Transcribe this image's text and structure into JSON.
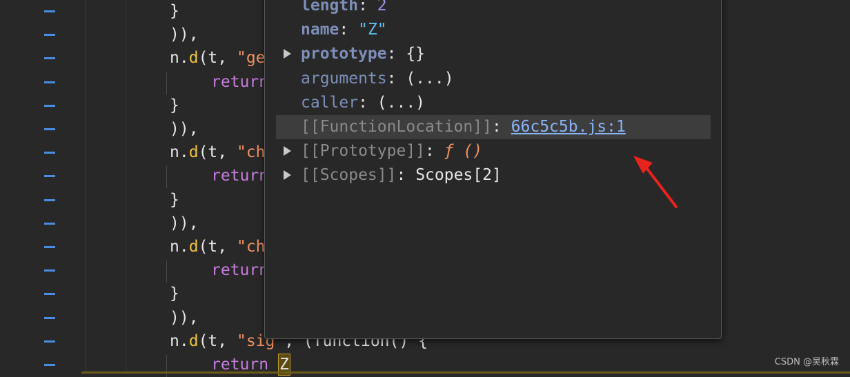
{
  "editor": {
    "lines": [
      {
        "kind": "brace",
        "text": "}"
      },
      {
        "kind": "close",
        "text": ")),"
      },
      {
        "kind": "call",
        "obj": "n",
        "dot": ".",
        "fn": "d",
        "open": "(t, ",
        "str": "\"ge"
      },
      {
        "kind": "return",
        "kw": "return"
      },
      {
        "kind": "brace",
        "text": "}"
      },
      {
        "kind": "close",
        "text": ")),"
      },
      {
        "kind": "call",
        "obj": "n",
        "dot": ".",
        "fn": "d",
        "open": "(t, ",
        "str": "\"ch"
      },
      {
        "kind": "return",
        "kw": "return"
      },
      {
        "kind": "brace",
        "text": "}"
      },
      {
        "kind": "close",
        "text": ")),"
      },
      {
        "kind": "call",
        "obj": "n",
        "dot": ".",
        "fn": "d",
        "open": "(t, ",
        "str": "\"ch"
      },
      {
        "kind": "return",
        "kw": "return"
      },
      {
        "kind": "brace",
        "text": "}"
      },
      {
        "kind": "close",
        "text": ")),"
      },
      {
        "kind": "call",
        "obj": "n",
        "dot": ".",
        "fn": "d",
        "open": "(t, ",
        "str": "\"sig",
        "tail": "\", (function() {"
      },
      {
        "kind": "return",
        "kw": "return",
        "hover": "Z"
      }
    ]
  },
  "popup": {
    "rows": [
      {
        "key": "length",
        "sep": ": ",
        "value": "2",
        "vtype": "num",
        "style": "bold",
        "expand": false
      },
      {
        "key": "name",
        "sep": ": ",
        "value": "\"Z\"",
        "vtype": "str",
        "style": "bold",
        "expand": false
      },
      {
        "key": "prototype",
        "sep": ": ",
        "value": "{}",
        "vtype": "plain",
        "style": "bold",
        "expand": true
      },
      {
        "key": "arguments",
        "sep": ": ",
        "value": "(...)",
        "vtype": "plain",
        "style": "normal",
        "expand": false
      },
      {
        "key": "caller",
        "sep": ": ",
        "value": "(...)",
        "vtype": "plain",
        "style": "normal",
        "expand": false
      },
      {
        "key": "[[FunctionLocation]]",
        "sep": ": ",
        "value": "66c5c5b.js:1",
        "vtype": "link",
        "style": "internal",
        "expand": false,
        "highlight": true
      },
      {
        "key": "[[Prototype]]",
        "sep": ": ",
        "value": "ƒ ()",
        "vtype": "fn",
        "style": "internal",
        "expand": true
      },
      {
        "key": "[[Scopes]]",
        "sep": ": ",
        "value": "Scopes[2]",
        "vtype": "plain",
        "style": "internal",
        "expand": true
      }
    ]
  },
  "watermark": "CSDN @吴秋霖",
  "colors": {
    "background": "#282828",
    "keyword": "#c57ddb",
    "function": "#f0c23b",
    "string": "#f09163",
    "link": "#8ab4f8",
    "annotation_arrow": "#e8231c",
    "gutter_marker": "#4a8de0"
  }
}
